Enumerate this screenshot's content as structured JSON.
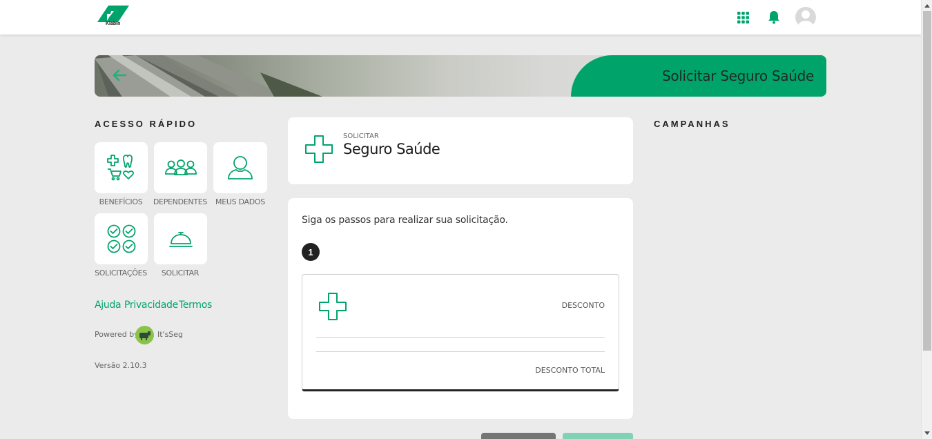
{
  "header": {
    "logo_text": "Klabin"
  },
  "banner": {
    "title": "Solicitar Seguro Saúde",
    "back_icon": "arrow-left-icon"
  },
  "quick_access": {
    "title": "ACESSO RÁPIDO",
    "tiles": [
      {
        "label": "BENEFÍCIOS",
        "icon": "benefits-icon"
      },
      {
        "label": "DEPENDENTES",
        "icon": "people-group-icon"
      },
      {
        "label": "MEUS DADOS",
        "icon": "user-icon"
      },
      {
        "label": "SOLICITAÇÕES",
        "icon": "checkmarks-icon"
      },
      {
        "label": "SOLICITAR",
        "icon": "service-bell-icon"
      }
    ]
  },
  "footer_links": {
    "help": "Ajuda",
    "privacy": "Privacidade",
    "terms": "Termos"
  },
  "powered": {
    "prefix": "Powered by",
    "brand": "It'sSeg"
  },
  "version": "Versão 2.10.3",
  "campaigns": {
    "title": "CAMPANHAS"
  },
  "request": {
    "small": "SOLICITAR",
    "big": "Seguro Saúde",
    "intro": "Siga os passos para realizar sua solicitação.",
    "step_number": "1",
    "discount_label": "DESCONTO",
    "total_discount_label": "DESCONTO TOTAL"
  },
  "colors": {
    "accent": "#00a46b",
    "background": "#ebebeb"
  }
}
